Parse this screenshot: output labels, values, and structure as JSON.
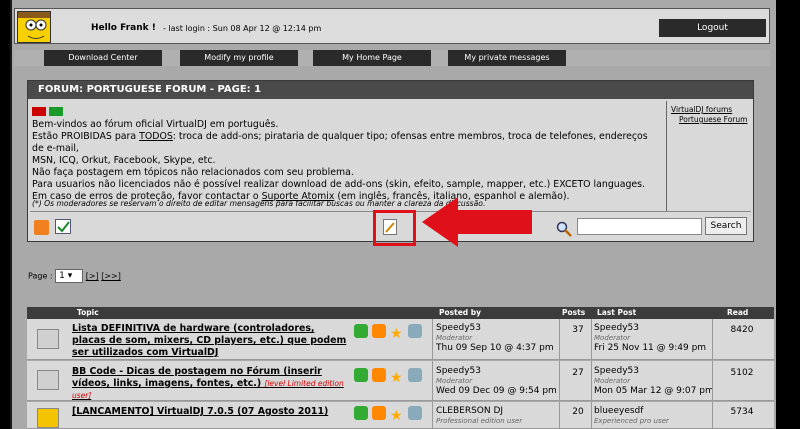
{
  "header": {
    "hello": "Hello Frank !",
    "last_login": "- last login : Sun 08 Apr 12 @ 12:14 pm",
    "logout": "Logout"
  },
  "nav": [
    "Download Center",
    "Modify my profile",
    "My Home Page",
    "My private messages"
  ],
  "forum": {
    "title": "FORUM: PORTUGUESE FORUM - PAGE: 1",
    "lines": [
      "Bem-vindos ao fórum oficial VirtualDJ em português.",
      [
        "Estão PROIBIDAS para ",
        "TODOS",
        ": troca de add-ons; pirataria de qualquer tipo; ofensas entre membros, troca de telefones, endereços de e-mail,"
      ],
      "MSN, ICQ, Orkut, Facebook, Skype, etc.",
      "Não faça postagem em tópicos não relacionados com seu problema.",
      "Para usuarios não licenciados não é possível realizar download de add-ons (skin, efeito, sample, mapper, etc.) EXCETO languages.",
      [
        "Em caso de erros de proteção, favor contactar o ",
        "Suporte Atomix",
        " (em inglês, francês, italiano, espanhol e alemão)."
      ]
    ],
    "note": "(*) Os moderadores se reservam o direito de editar mensagens para facilitar buscas ou manter a clareza da discussão.",
    "breadcrumb": [
      "VirtualDJ forums",
      "Portuguese Forum"
    ],
    "search_button": "Search",
    "search_value": ""
  },
  "pager": {
    "label": "Page :",
    "value": "1",
    "links": [
      "[>]",
      "[>>]"
    ]
  },
  "table": {
    "headers": [
      "Topic",
      "Posted by",
      "Posts",
      "Last Post",
      "Read"
    ],
    "rows": [
      {
        "title": "Lista DEFINITIVA de hardware (controladores, placas de som, mixers, CD players, etc.) que podem ser utilizados com VirtualDJ",
        "tag": "",
        "poster": "Speedy53",
        "poster_role": "Moderator",
        "posted": "Thu 09 Sep 10 @ 4:37 pm",
        "posts": "37",
        "last_user": "Speedy53",
        "last_role": "Moderator",
        "last_date": "Fri 25 Nov 11 @ 9:49 pm",
        "reads": "8420"
      },
      {
        "title": "BB Code - Dicas de postagem no Fórum (inserir vídeos, links, imagens, fontes, etc.)",
        "tag": "[level Limited edition user]",
        "poster": "Speedy53",
        "poster_role": "Moderator",
        "posted": "Wed 09 Dec 09 @ 9:54 pm",
        "posts": "27",
        "last_user": "Speedy53",
        "last_role": "Moderator",
        "last_date": "Mon 05 Mar 12 @ 9:07 pm",
        "reads": "5102"
      },
      {
        "title": "[LANCAMENTO] VirtualDJ 7.0.5 (07 Agosto 2011)",
        "tag": "",
        "poster": "CLEBERSON DJ",
        "poster_role": "Professional edition user",
        "posted": "",
        "posts": "20",
        "last_user": "blueeyesdf",
        "last_role": "Experienced pro user",
        "last_date": "",
        "reads": "5734"
      }
    ]
  },
  "colors": {
    "arrow": "#e0101a",
    "header": "#4a4a4a",
    "panel": "#d9d9d9"
  }
}
